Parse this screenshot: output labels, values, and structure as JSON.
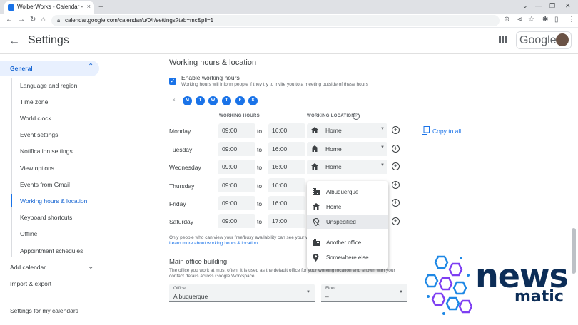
{
  "browser": {
    "tab_title": "WolberWorks - Calendar - General",
    "tab_close": "×",
    "new_tab": "+",
    "url": "calendar.google.com/calendar/u/0/r/settings?tab=mc&pli=1",
    "window_controls": [
      "⌄",
      "—",
      "❐",
      "✕"
    ]
  },
  "header": {
    "title": "Settings",
    "logo_text": "Google"
  },
  "sidebar": {
    "general": "General",
    "items": [
      "Language and region",
      "Time zone",
      "World clock",
      "Event settings",
      "Notification settings",
      "View options",
      "Events from Gmail",
      "Working hours & location",
      "Keyboard shortcuts",
      "Offline",
      "Appointment schedules"
    ],
    "active_item": "Working hours & location",
    "add_calendar": "Add calendar",
    "import_export": "Import & export",
    "settings_for_my_calendars": "Settings for my calendars"
  },
  "main": {
    "section_title": "Working hours & location",
    "enable_label": "Enable working hours",
    "enable_desc": "Working hours will inform people if they try to invite you to a meeting outside of these hours",
    "enable_checked": true,
    "days": [
      {
        "letter": "S",
        "on": false
      },
      {
        "letter": "M",
        "on": true
      },
      {
        "letter": "T",
        "on": true
      },
      {
        "letter": "W",
        "on": true
      },
      {
        "letter": "T",
        "on": true
      },
      {
        "letter": "F",
        "on": true
      },
      {
        "letter": "S",
        "on": true
      }
    ],
    "col_hours": "WORKING HOURS",
    "col_location": "WORKING LOCATION",
    "help": "?",
    "to_label": "to",
    "rows": [
      {
        "day": "Monday",
        "start": "09:00",
        "end": "16:00",
        "location": "Home"
      },
      {
        "day": "Tuesday",
        "start": "09:00",
        "end": "16:00",
        "location": "Home"
      },
      {
        "day": "Wednesday",
        "start": "09:00",
        "end": "16:00",
        "location": "Home"
      },
      {
        "day": "Thursday",
        "start": "09:00",
        "end": "16:00",
        "location": ""
      },
      {
        "day": "Friday",
        "start": "09:00",
        "end": "16:00",
        "location": ""
      },
      {
        "day": "Saturday",
        "start": "09:00",
        "end": "17:00",
        "location": ""
      }
    ],
    "copy_to_all": "Copy to all",
    "note_line1": "Only people who can view your free/busy availability can see your working location",
    "note_link": "Learn more about working hours & location.",
    "main_office_title": "Main office building",
    "main_office_desc1": "The office you work at most often. It is used as the default office for your working location and shown with your",
    "main_office_desc2": "contact details across Google Workspace.",
    "office_label": "Office",
    "office_value": "Albuquerque",
    "floor_label": "Floor",
    "floor_value": "–"
  },
  "location_menu": {
    "items": [
      {
        "label": "Albuquerque",
        "icon": "building-icon"
      },
      {
        "label": "Home",
        "icon": "home-icon"
      },
      {
        "label": "Unspecified",
        "icon": "location-off-icon",
        "selected": true
      },
      {
        "label": "Another office",
        "icon": "building-icon"
      },
      {
        "label": "Somewhere else",
        "icon": "location-pin-icon"
      }
    ]
  },
  "watermark": {
    "word1": "news",
    "word2": "matic"
  },
  "colors": {
    "accent": "#1a73e8",
    "active_bg": "#e8f0fe",
    "watermark_text": "#0c2d57"
  }
}
